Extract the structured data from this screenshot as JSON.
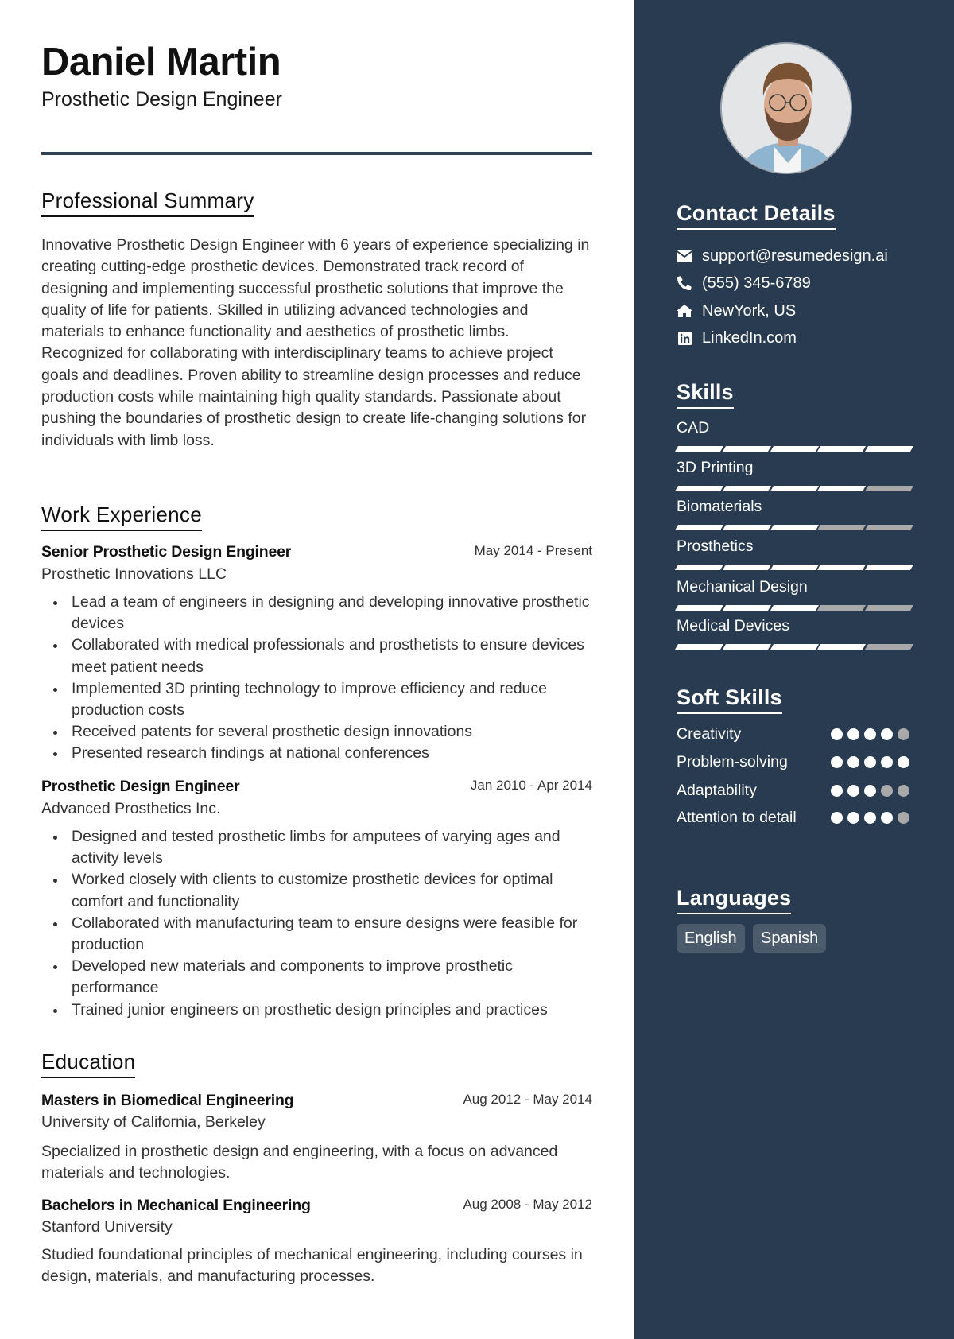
{
  "header": {
    "name": "Daniel Martin",
    "title": "Prosthetic Design Engineer"
  },
  "summary": {
    "heading": "Professional Summary",
    "text": "Innovative Prosthetic Design Engineer with 6 years of experience specializing in creating cutting-edge prosthetic devices. Demonstrated track record of designing and implementing successful prosthetic solutions that improve the quality of life for patients. Skilled in utilizing advanced technologies and materials to enhance functionality and aesthetics of prosthetic limbs. Recognized for collaborating with interdisciplinary teams to achieve project goals and deadlines. Proven ability to streamline design processes and reduce production costs while maintaining high quality standards. Passionate about pushing the boundaries of prosthetic design to create life-changing solutions for individuals with limb loss."
  },
  "experience": {
    "heading": "Work Experience",
    "jobs": [
      {
        "role": "Senior Prosthetic Design Engineer",
        "dates": "May 2014 - Present",
        "company": "Prosthetic Innovations LLC",
        "bullets": [
          "Lead a team of engineers in designing and developing innovative prosthetic devices",
          "Collaborated with medical professionals and prosthetists to ensure devices meet patient needs",
          "Implemented 3D printing technology to improve efficiency and reduce production costs",
          "Received patents for several prosthetic design innovations",
          "Presented research findings at national conferences"
        ]
      },
      {
        "role": "Prosthetic Design Engineer",
        "dates": "Jan 2010 - Apr 2014",
        "company": "Advanced Prosthetics Inc.",
        "bullets": [
          "Designed and tested prosthetic limbs for amputees of varying ages and activity levels",
          "Worked closely with clients to customize prosthetic devices for optimal comfort and functionality",
          "Collaborated with manufacturing team to ensure designs were feasible for production",
          "Developed new materials and components to improve prosthetic performance",
          "Trained junior engineers on prosthetic design principles and practices"
        ]
      }
    ]
  },
  "education": {
    "heading": "Education",
    "items": [
      {
        "degree": "Masters in Biomedical Engineering",
        "dates": "Aug 2012 - May 2014",
        "school": "University of California, Berkeley",
        "description": "Specialized in prosthetic design and engineering, with a focus on advanced materials and technologies."
      },
      {
        "degree": "Bachelors in Mechanical Engineering",
        "dates": "Aug 2008 - May 2012",
        "school": "Stanford University",
        "description": "Studied foundational principles of mechanical engineering, including courses in design, materials, and manufacturing processes."
      }
    ]
  },
  "sidebar": {
    "photo_alt": "Profile photo of Daniel Martin",
    "contact": {
      "heading": "Contact Details",
      "items": [
        {
          "icon": "envelope-icon",
          "text": "support@resumedesign.ai"
        },
        {
          "icon": "phone-icon",
          "text": "(555) 345-6789"
        },
        {
          "icon": "home-icon",
          "text": "NewYork, US"
        },
        {
          "icon": "linkedin-icon",
          "text": "LinkedIn.com"
        }
      ]
    },
    "skills": {
      "heading": "Skills",
      "max_level": 5,
      "items": [
        {
          "name": "CAD",
          "level": 5
        },
        {
          "name": "3D Printing",
          "level": 4
        },
        {
          "name": "Biomaterials",
          "level": 3
        },
        {
          "name": "Prosthetics",
          "level": 5
        },
        {
          "name": "Mechanical Design",
          "level": 3
        },
        {
          "name": "Medical Devices",
          "level": 4
        }
      ]
    },
    "soft_skills": {
      "heading": "Soft Skills",
      "max_level": 5,
      "items": [
        {
          "name": "Creativity",
          "level": 4
        },
        {
          "name": "Problem-solving",
          "level": 5
        },
        {
          "name": "Adaptability",
          "level": 3
        },
        {
          "name": "Attention to detail",
          "level": 4
        }
      ]
    },
    "languages": {
      "heading": "Languages",
      "items": [
        "English",
        "Spanish"
      ]
    }
  },
  "colors": {
    "sidebar_bg": "#283b50",
    "header_rule": "#2e4156",
    "level_on": "#ffffff",
    "level_off": "#a9a9a9",
    "chip_bg": "#4b5b6c"
  }
}
